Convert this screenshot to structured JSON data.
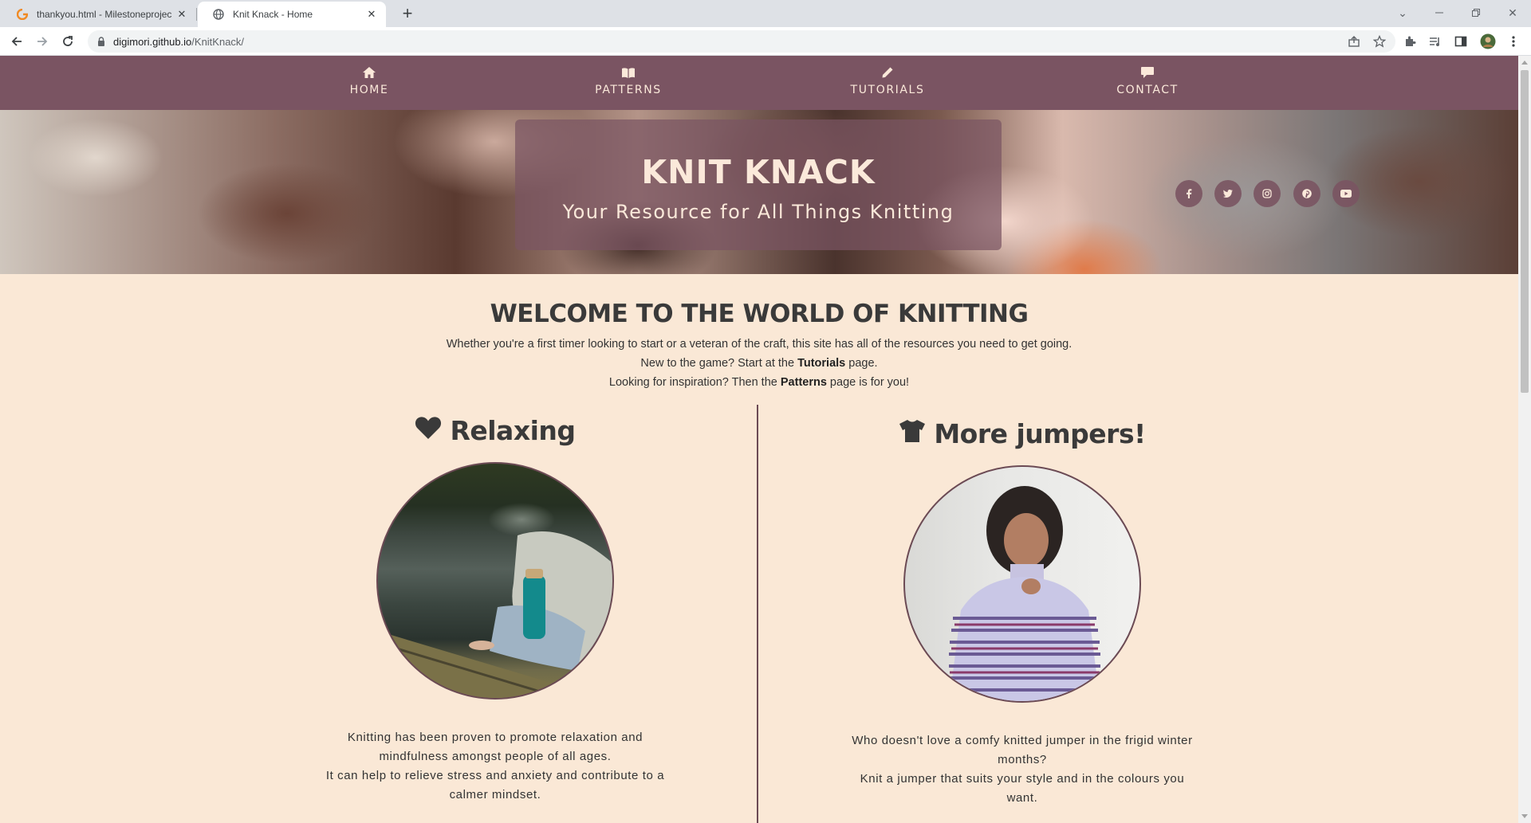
{
  "browser": {
    "tabs": [
      {
        "title": "thankyou.html - Milestoneprojec",
        "active": false
      },
      {
        "title": "Knit Knack - Home",
        "active": true
      }
    ],
    "url_host": "digimori.github.io",
    "url_path": "/KnitKnack/"
  },
  "nav": {
    "items": [
      {
        "label": "HOME",
        "icon": "home-icon"
      },
      {
        "label": "PATTERNS",
        "icon": "book-icon"
      },
      {
        "label": "TUTORIALS",
        "icon": "pencil-icon"
      },
      {
        "label": "CONTACT",
        "icon": "comment-icon"
      }
    ]
  },
  "hero": {
    "title": "KNIT KNACK",
    "subtitle": "Your Resource for All Things Knitting",
    "social": [
      "facebook-icon",
      "twitter-icon",
      "instagram-icon",
      "pinterest-icon",
      "youtube-icon"
    ]
  },
  "welcome": {
    "heading": "WELCOME TO THE WORLD OF KNITTING",
    "line1": "Whether you're a first timer looking to start or a veteran of the craft, this site has all of the resources you need to get going.",
    "line2_pre": "New to the game? Start at the ",
    "line2_link": "Tutorials",
    "line2_post": " page.",
    "line3_pre": "Looking for inspiration? Then the ",
    "line3_link": "Patterns",
    "line3_post": " page is for you!"
  },
  "features": [
    {
      "title": "Relaxing",
      "icon": "heart-icon",
      "lines": [
        "Knitting has been proven to promote relaxation and",
        "mindfulness amongst people of all ages.",
        "It can help to relieve stress and anxiety and contribute to a",
        "calmer mindset."
      ]
    },
    {
      "title": "More jumpers!",
      "icon": "shirt-icon",
      "lines": [
        "Who doesn't love a comfy knitted jumper in the frigid winter",
        "months?",
        "Knit a jumper that suits your style and in the colours you",
        "want."
      ]
    }
  ],
  "colors": {
    "nav_bg": "#7a5462",
    "page_bg": "#fae8d6",
    "text_light": "#fbe9da"
  }
}
